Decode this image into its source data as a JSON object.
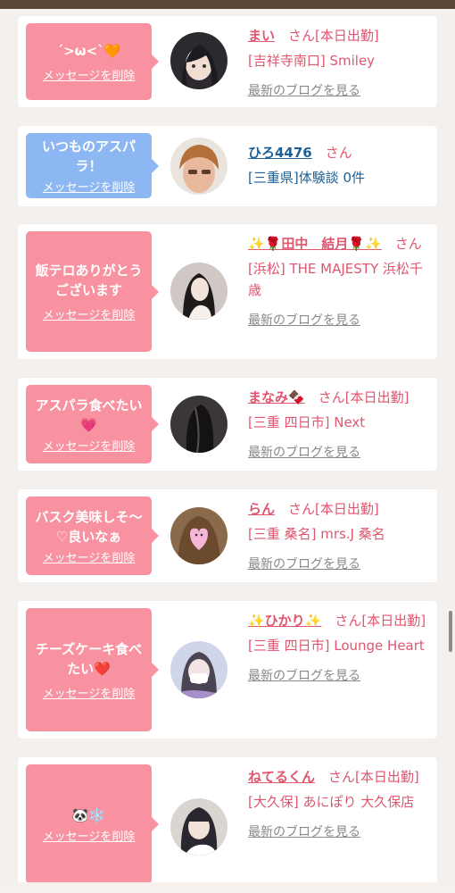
{
  "delete_label": "メッセージを削除",
  "blog_label": "最新のブログを見る",
  "san_label": "さん",
  "cards": [
    {
      "message": "´>ω<`🧡",
      "name": "まい",
      "status": "[本日出勤]",
      "shop": "[吉祥寺南口] Smiley"
    },
    {
      "message": "いつものアスパラ！",
      "name": "ひろ4476",
      "shop": "[三重県]体験談 0件"
    },
    {
      "message": "飯テロありがとうございます",
      "name": "✨🌹田中　結月🌹✨",
      "shop": "[浜松] THE MAJESTY 浜松千歳"
    },
    {
      "message": "アスパラ食べたい💗",
      "name": "まなみ🍫",
      "status": "[本日出勤]",
      "shop": "[三重 四日市] Next"
    },
    {
      "message": "バスク美味しそ〜♡良いなぁ",
      "name": "らん",
      "status": "[本日出勤]",
      "shop": "[三重 桑名] mrs.J 桑名"
    },
    {
      "message": "チーズケーキ食べたい❤️",
      "name": "✨ひかり✨",
      "status": "[本日出勤]",
      "shop": "[三重 四日市] Lounge Heart"
    },
    {
      "message": "🐼❄️",
      "name": "ねてるくん",
      "status": "[本日出勤]",
      "shop": "[大久保] あにぽり 大久保店"
    }
  ]
}
